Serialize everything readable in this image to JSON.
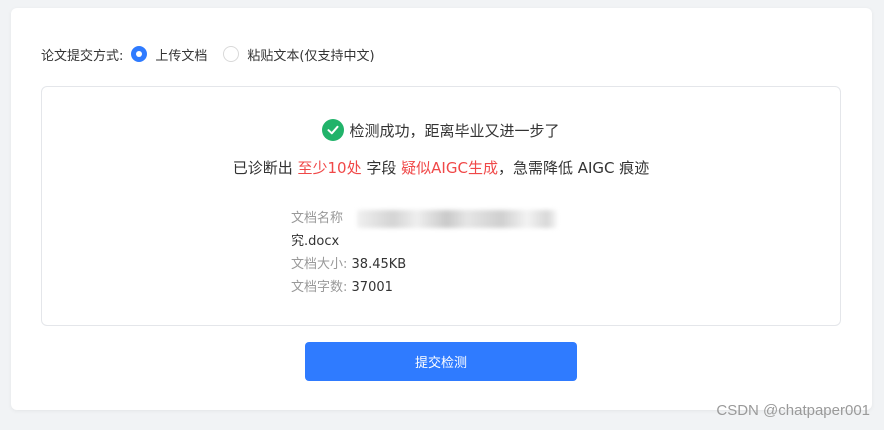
{
  "method": {
    "label": "论文提交方式:",
    "options": [
      {
        "label": "上传文档",
        "selected": true
      },
      {
        "label": "粘贴文本(仅支持中文)",
        "selected": false
      }
    ]
  },
  "result": {
    "success_text": "检测成功，距离毕业又进一步了",
    "diag_prefix": "已诊断出",
    "diag_count": "至少10处",
    "diag_mid": "字段",
    "diag_flag": "疑似AIGC生成",
    "diag_suffix": "，急需降低 AIGC 痕迹",
    "check_icon": "check-circle-icon",
    "colors": {
      "success": "#21b36a",
      "warning": "#f04848"
    }
  },
  "document": {
    "name_label": "文档名称",
    "name_tail": "究.docx",
    "size_label": "文档大小:",
    "size_value": "38.45KB",
    "words_label": "文档字数:",
    "words_value": "37001"
  },
  "submit": {
    "label": "提交检测",
    "color": "#2f7bff"
  },
  "watermark": "CSDN @chatpaper001"
}
